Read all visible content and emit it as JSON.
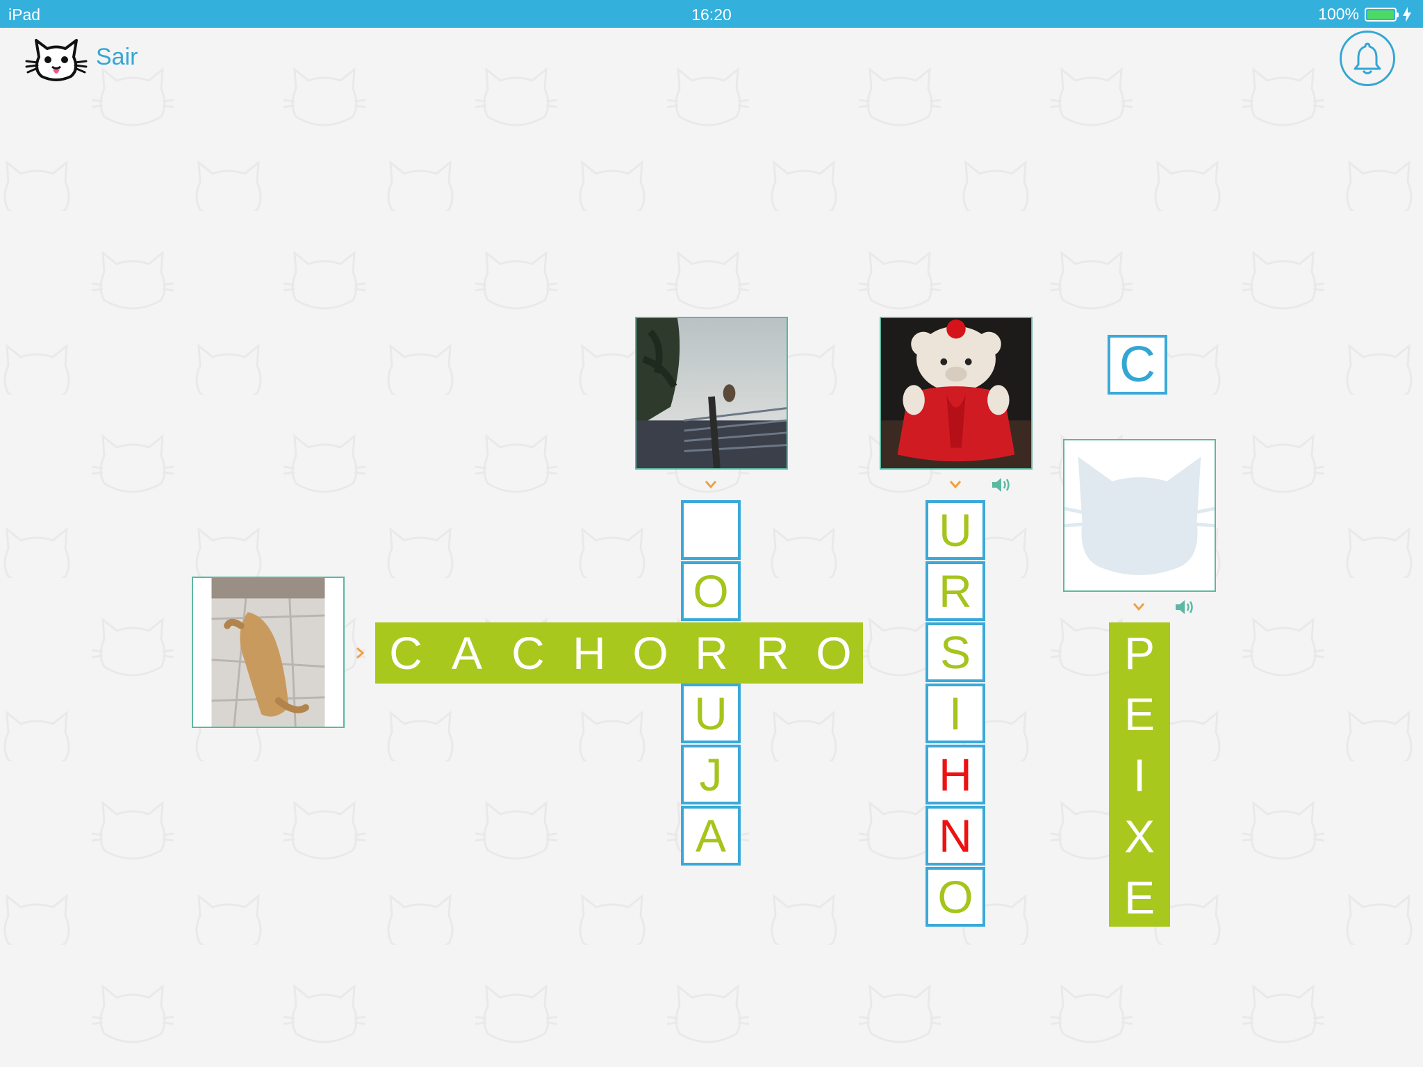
{
  "status_bar": {
    "device": "iPad",
    "time": "16:20",
    "battery_percent": "100%"
  },
  "header": {
    "exit_label": "Sair"
  },
  "colors": {
    "accent": "#34a6d4",
    "status_bar": "#34b0dc",
    "correct": "#a5c41c",
    "error": "#ee1111",
    "solved_bg": "#a8c81e"
  },
  "clues": [
    {
      "id": "cachorro",
      "image": "sleeping-dog-photo",
      "direction": "horizontal"
    },
    {
      "id": "coruja",
      "image": "owl-on-fence-photo",
      "direction": "vertical"
    },
    {
      "id": "ursinho",
      "image": "teddy-bear-photo",
      "direction": "vertical",
      "audio": true
    },
    {
      "id": "peixe",
      "image": "placeholder-cat-silhouette",
      "direction": "vertical",
      "audio": true
    }
  ],
  "words": {
    "cachorro": {
      "letters": [
        "C",
        "A",
        "C",
        "H",
        "O",
        "R",
        "R",
        "O"
      ],
      "solved": true
    },
    "coruja": {
      "letters": [
        "",
        "O",
        "R",
        "U",
        "J",
        "A"
      ],
      "solved": false
    },
    "ursinho": {
      "letters": [
        "U",
        "R",
        "S",
        "I",
        "H",
        "N",
        "O"
      ],
      "errors": [
        4,
        5
      ],
      "solved": false
    },
    "peixe": {
      "letters": [
        "P",
        "E",
        "I",
        "X",
        "E"
      ],
      "solved": true
    }
  },
  "floating_letter": "C"
}
